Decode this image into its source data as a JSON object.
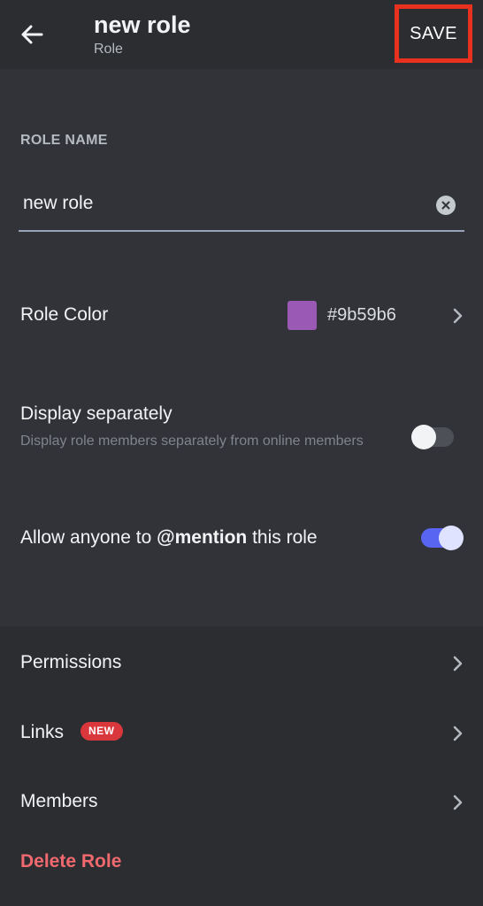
{
  "header": {
    "title": "new role",
    "subtitle": "Role",
    "save_label": "SAVE"
  },
  "role_name": {
    "section_label": "ROLE NAME",
    "value": "new role"
  },
  "role_color": {
    "label": "Role Color",
    "hex": "#9b59b6",
    "swatch_color": "#9b59b6"
  },
  "display_separately": {
    "label": "Display separately",
    "description": "Display role members separately from online members",
    "enabled": false
  },
  "mentionable": {
    "prefix": "Allow anyone to ",
    "bold": "@mention",
    "suffix": " this role",
    "enabled": true
  },
  "nav": {
    "permissions": "Permissions",
    "links": "Links",
    "links_badge": "NEW",
    "members": "Members"
  },
  "delete_label": "Delete Role",
  "colors": {
    "background": "#313338",
    "header_bg": "#2b2d31",
    "accent": "#5865f2",
    "danger": "#f0696f",
    "highlight_border": "#e8321f"
  }
}
